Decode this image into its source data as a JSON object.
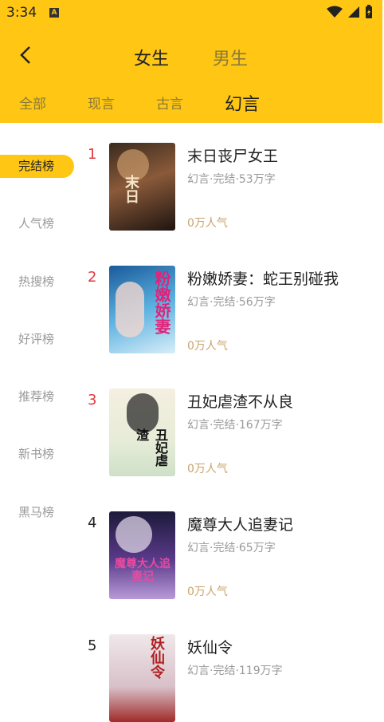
{
  "status": {
    "time": "3:34",
    "notification_icon": "A"
  },
  "header": {
    "back_icon": "chevron-left",
    "genders": [
      "女生",
      "男生"
    ],
    "categories": [
      "全部",
      "现言",
      "古言",
      "幻言"
    ],
    "active_category": "幻言"
  },
  "sidebar": {
    "items": [
      {
        "label": "完结榜"
      },
      {
        "label": "人气榜"
      },
      {
        "label": "热搜榜"
      },
      {
        "label": "好评榜"
      },
      {
        "label": "推荐榜"
      },
      {
        "label": "新书榜"
      },
      {
        "label": "黑马榜"
      }
    ]
  },
  "books": [
    {
      "rank": "1",
      "title": "末日丧尸女王",
      "meta": "幻言·完结·53万字",
      "popularity": "0万人气",
      "cover_text": "末日"
    },
    {
      "rank": "2",
      "title": "粉嫩娇妻：蛇王别碰我",
      "meta": "幻言·完结·56万字",
      "popularity": "0万人气",
      "cover_text": "粉嫩娇妻"
    },
    {
      "rank": "3",
      "title": "丑妃虐渣不从良",
      "meta": "幻言·完结·167万字",
      "popularity": "0万人气",
      "cover_text": "丑妃虐渣"
    },
    {
      "rank": "4",
      "title": "魔尊大人追妻记",
      "meta": "幻言·完结·65万字",
      "popularity": "0万人气",
      "cover_text": "魔尊大人追妻记"
    },
    {
      "rank": "5",
      "title": "妖仙令",
      "meta": "幻言·完结·119万字",
      "popularity": "",
      "cover_text": "妖仙令"
    }
  ],
  "colors": {
    "accent": "#FFC614",
    "rank_top": "#E0393E",
    "rank_normal": "#222222",
    "popularity": "#C9A46B"
  }
}
